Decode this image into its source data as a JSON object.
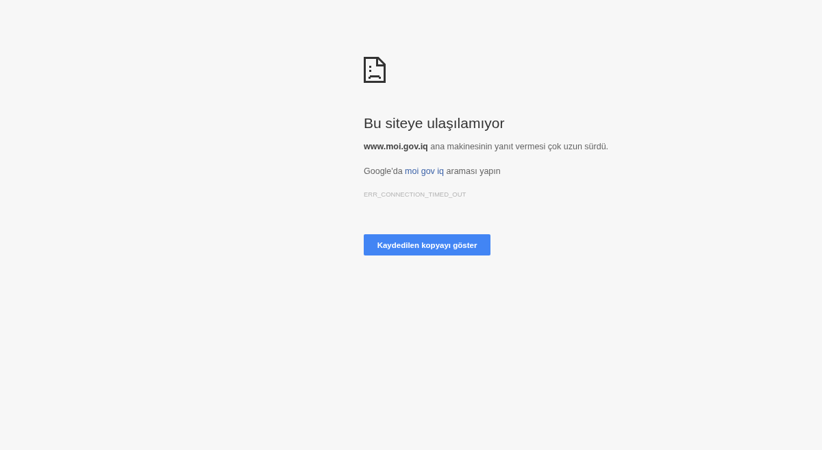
{
  "heading": "Bu siteye ulaşılamıyor",
  "summary": "**www.moi.gov.iq** ana makinesinin yanıt vermesi çok uzun sürdü.",
  "suggestion": {
    "prefix": "Google'da",
    "link": "moi gov iq",
    "suffix": "araması yapın"
  },
  "error_code": "ERR_CONNECTION_TIMED_OUT",
  "button": "Kaydedilen kopyayı göster"
}
